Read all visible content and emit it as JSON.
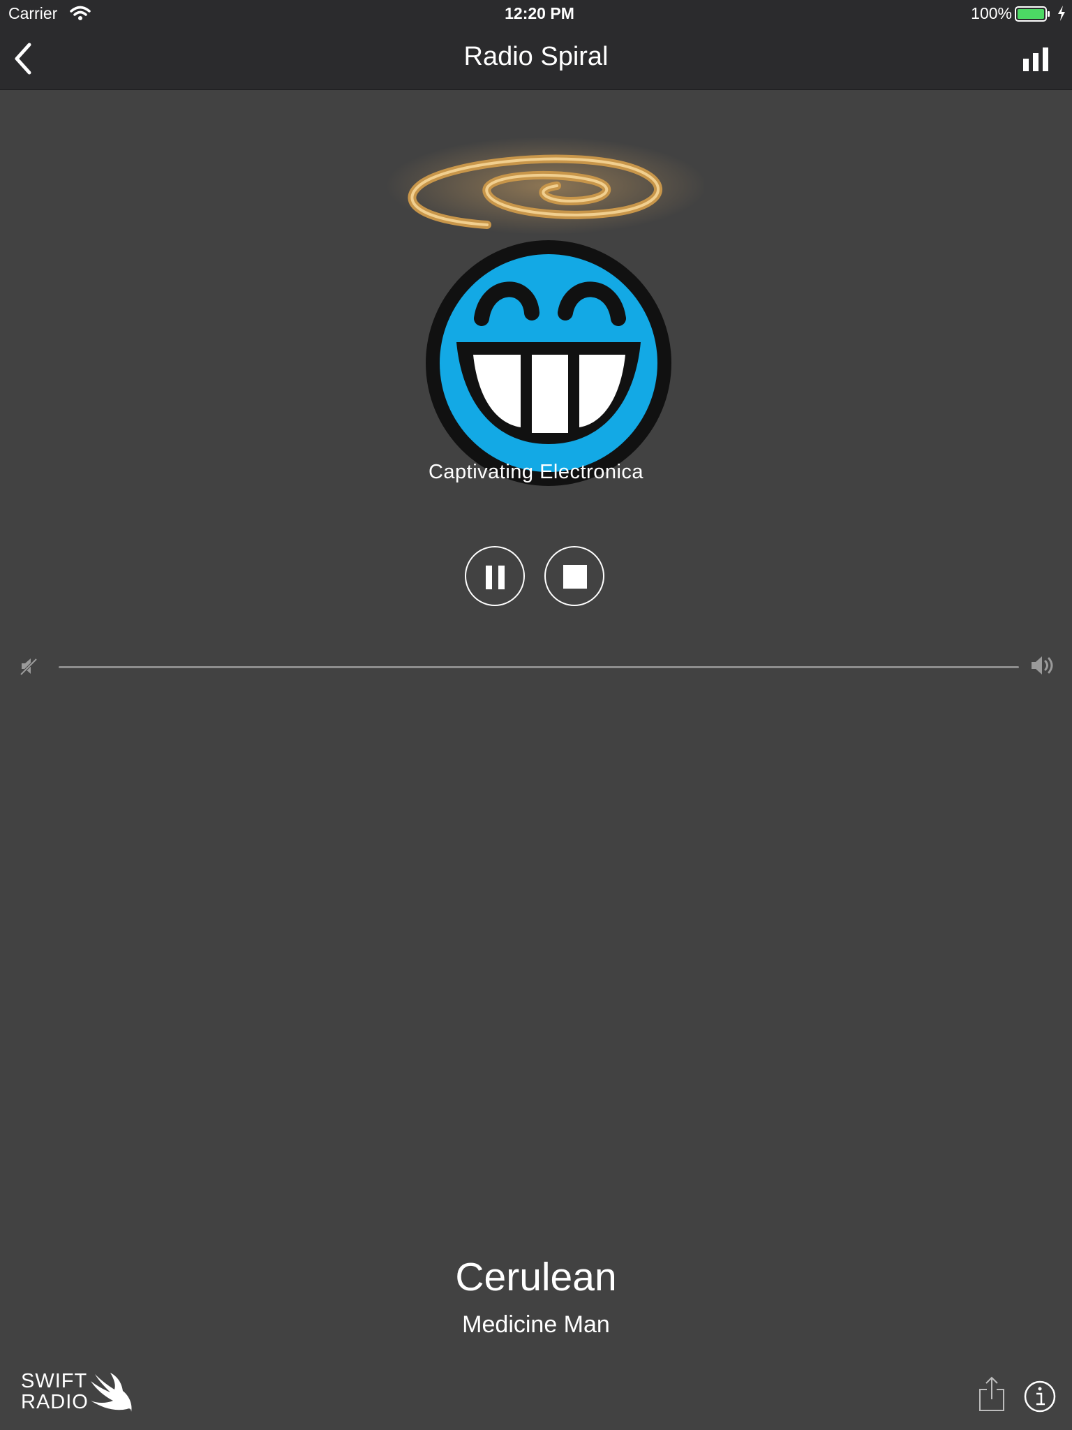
{
  "status_bar": {
    "carrier": "Carrier",
    "time": "12:20 PM",
    "battery_percent": "100%",
    "icons": [
      "wifi-icon",
      "battery-icon",
      "charging-bolt-icon"
    ]
  },
  "nav": {
    "title": "Radio Spiral",
    "back_icon": "chevron-left-icon",
    "right_icon": "now-playing-bars-icon"
  },
  "station": {
    "description": "Captivating Electronica",
    "artwork": "radio-spiral-logo"
  },
  "controls": {
    "pause_icon": "pause-icon",
    "stop_icon": "stop-icon"
  },
  "volume": {
    "level": 0.0,
    "min_icon": "volume-min-icon",
    "max_icon": "volume-max-icon"
  },
  "track": {
    "title": "Cerulean",
    "artist": "Medicine Man"
  },
  "footer": {
    "logo_line1": "SWIFT",
    "logo_line2": "RADIO",
    "share_icon": "share-icon",
    "info_icon": "info-icon"
  },
  "colors": {
    "background": "#424242",
    "bar": "#2b2b2d",
    "text": "#ffffff",
    "logo_face": "#13a9e5",
    "spiral": "#c8964a",
    "battery": "#4cd964"
  }
}
